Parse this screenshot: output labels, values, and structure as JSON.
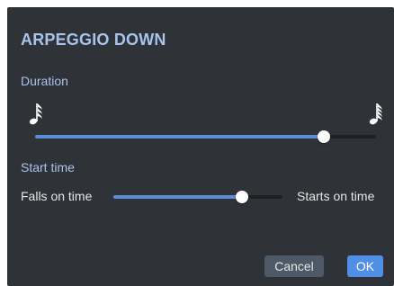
{
  "dialog": {
    "title": "ARPEGGIO DOWN",
    "duration": {
      "label": "Duration",
      "left_icon": "sixteenth-note-icon",
      "right_icon": "thirty-second-note-icon",
      "value_fraction": 0.846
    },
    "start_time": {
      "label": "Start time",
      "left_label": "Falls on time",
      "right_label": "Starts on time",
      "value_fraction": 0.76
    },
    "buttons": {
      "cancel_label": "Cancel",
      "ok_label": "OK"
    }
  },
  "colors": {
    "panel_bg": "#2f3237",
    "title": "#a8c3ec",
    "slider_fill": "#5b8cd8",
    "slider_track": "#1e2024",
    "ok_button": "#4f8fe6",
    "cancel_button": "#4d5966"
  }
}
